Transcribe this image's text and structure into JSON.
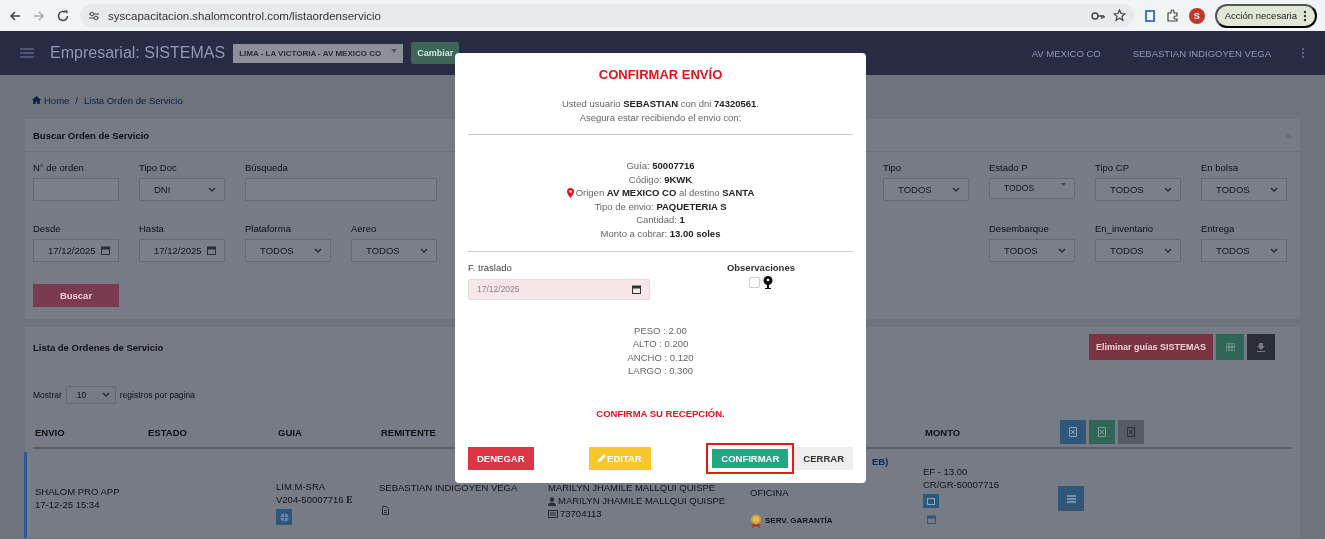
{
  "browser": {
    "url": "syscapacitacion.shalomcontrol.com/listaordenservicio",
    "profile_initial": "S",
    "action_label": "Acción necesaria"
  },
  "header": {
    "title": "Empresarial: SISTEMAS",
    "branch": "LIMA - LA VICTORIA - AV MEXICO CO",
    "change_button": "Cambiar",
    "agency": "AV MEXICO CO",
    "user": "SEBASTIAN INDIGOYEN VEGA"
  },
  "breadcrumb": {
    "items": [
      "Home",
      "Lista Orden de Servicio"
    ],
    "separator": "/"
  },
  "search_panel": {
    "title": "Buscar Orden de Servicio",
    "rows": [
      {
        "left": [
          {
            "label": "N° de orden",
            "kind": "text"
          },
          {
            "label": "Tipo Doc",
            "kind": "select",
            "value": "DNI"
          },
          {
            "label": "Búsqueda",
            "kind": "search"
          }
        ],
        "right": [
          {
            "label": "Tipo",
            "kind": "select",
            "value": "TODOS"
          },
          {
            "label": "Estado P",
            "kind": "multiselect",
            "value": "TODOS"
          },
          {
            "label": "Tipo CP",
            "kind": "select",
            "value": "TODOS"
          },
          {
            "label": "En bolsa",
            "kind": "select",
            "value": "TODOS"
          }
        ]
      },
      {
        "left": [
          {
            "label": "Desde",
            "kind": "date",
            "value": "17/12/2025"
          },
          {
            "label": "Hasta",
            "kind": "date",
            "value": "17/12/2025"
          },
          {
            "label": "Plataforma",
            "kind": "select",
            "value": "TODOS"
          },
          {
            "label": "Aereo",
            "kind": "select",
            "value": "TODOS"
          }
        ],
        "right": [
          {
            "label": "Desembarque",
            "kind": "select",
            "value": "TODOS"
          },
          {
            "label": "En_inventario",
            "kind": "select",
            "value": "TODOS"
          },
          {
            "label": "Entrega",
            "kind": "select",
            "value": "TODOS"
          }
        ]
      }
    ],
    "button": "Buscar"
  },
  "list_panel": {
    "title": "Lista de Ordenes de Servicio",
    "delete_button": "Eliminar guías SISTEMAS",
    "page_size_prefix": "Mostrar",
    "page_size": "10",
    "page_size_suffix": "registros por pagina"
  },
  "table": {
    "columns": [
      "ENVIO",
      "ESTADO",
      "GUIA",
      "REMITENTE",
      "MONTO"
    ],
    "rows": [
      {
        "envio": [
          "SHALOM PRO APP",
          "17-12-25 15:34"
        ],
        "guia": [
          "LIM.M-SRA",
          "V204-50007716"
        ],
        "guia_mark": "E",
        "remitente": "SEBASTIAN INDIGOYEN VEGA",
        "column_5": {
          "name": "MARILYN JHAMILE MALLQUI QUISPE",
          "contact": "MARILYN JHAMILE MALLQUI QUISPE",
          "document": "73704113"
        },
        "column_6": {
          "fragment": "EB)",
          "place": "OFICINA",
          "badge": "SERV. GARANTÍA"
        },
        "monto": [
          "EF - 13.00",
          "CR/GR-50007716"
        ]
      }
    ]
  },
  "modal": {
    "title": "CONFIRMAR ENVÍO",
    "intro": [
      "Usted usuario **SEBASTIAN** con dni **74320561**.",
      "Asegura estar recibiendo el envio con:"
    ],
    "details": [
      {
        "kind": "plain",
        "text": "Guía: **50007716**"
      },
      {
        "kind": "plain",
        "text": "Código: **9KWK**"
      },
      {
        "kind": "origin",
        "text": "Origen **AV MEXICO CO** al destino **SANTA**"
      },
      {
        "kind": "plain",
        "text": "Tipo de envio: **PAQUETERIA S**"
      },
      {
        "kind": "plain",
        "text": "Cantidad: **1**"
      },
      {
        "kind": "plain",
        "text": "Monto a cobrar: **13.00 soles**"
      }
    ],
    "date_label": "F. traslado",
    "date": "17/12/2025",
    "observations_label": "Observaciones",
    "observations_checked": false,
    "measures": [
      "PESO : 2.00",
      "ALTO : 0.200",
      "ANCHO : 0.120",
      "LARGO : 0.300"
    ],
    "note": "CONFIRMA SU RECEPCIÓN.",
    "buttons": [
      {
        "label": "DENEGAR",
        "kind": "danger",
        "focused": false
      },
      {
        "label": "EDITAR",
        "kind": "warning",
        "focused": false
      },
      {
        "label": "CONFIRMAR",
        "kind": "success",
        "focused": true
      },
      {
        "label": "CERRAR",
        "kind": "light",
        "focused": false
      }
    ]
  }
}
